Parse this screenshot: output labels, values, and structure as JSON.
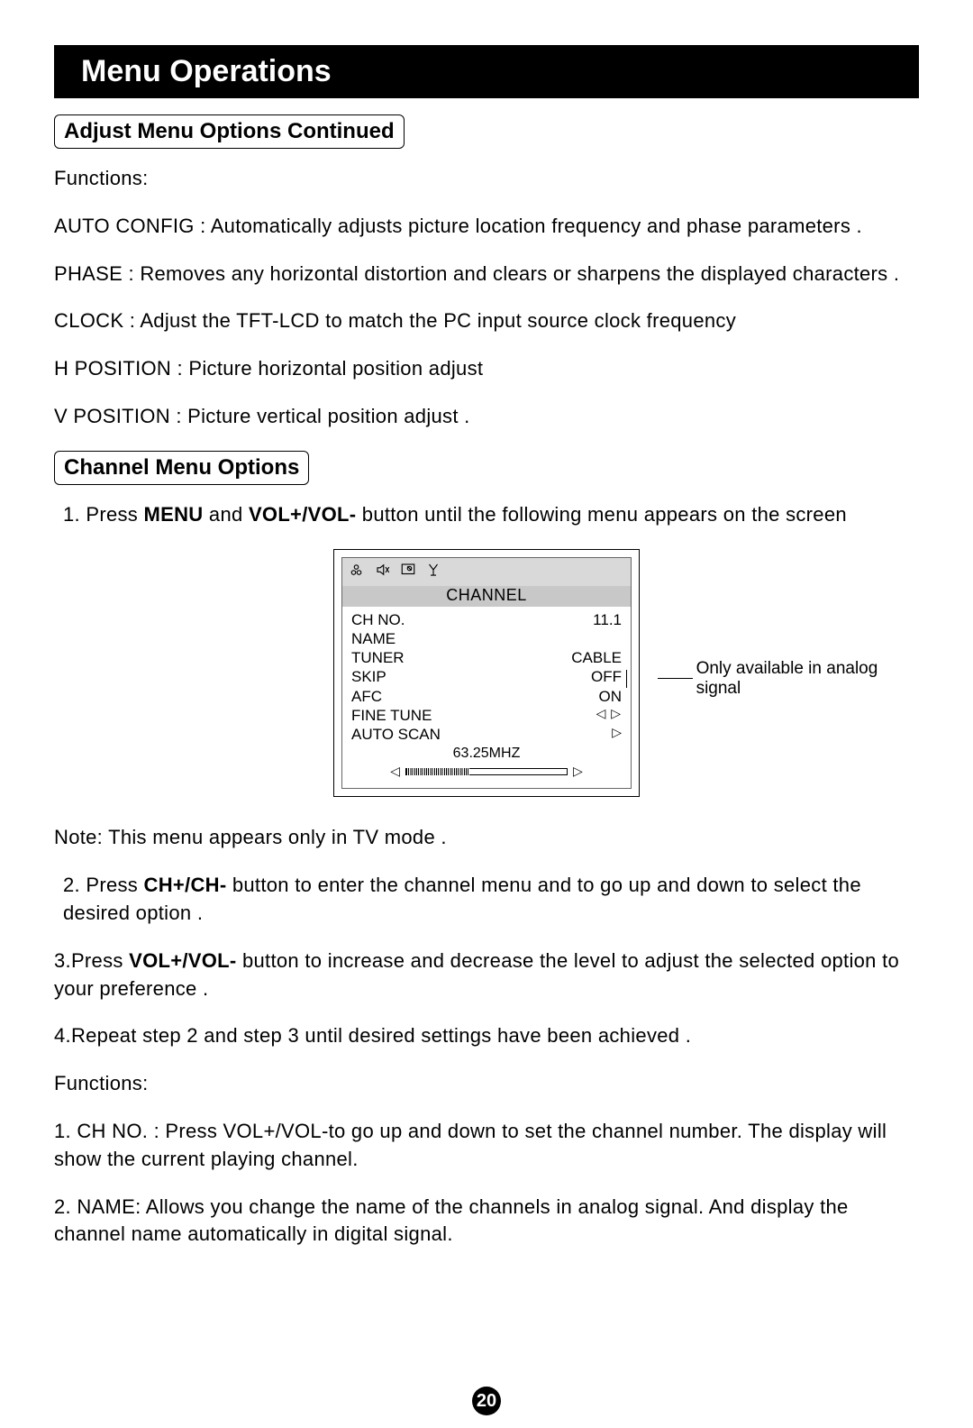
{
  "header": "Menu Operations",
  "section1": {
    "title": "Adjust  Menu Options Continued",
    "functions_label": "Functions:",
    "items": [
      "AUTO CONFIG : Automatically adjusts picture location frequency and phase parameters .",
      "PHASE : Removes any horizontal distortion and clears or sharpens the displayed characters .",
      "CLOCK : Adjust the TFT-LCD to match the PC input source clock frequency",
      "H POSITION : Picture horizontal position adjust",
      "V POSITION : Picture vertical position adjust ."
    ]
  },
  "section2": {
    "title": "Channel Menu  Options",
    "step1_prefix": " 1. Press ",
    "step1_bold1": "MENU",
    "step1_mid": " and ",
    "step1_bold2": "VOL+/VOL-",
    "step1_suffix": " button until the following menu appears on the screen",
    "note": " Note: This menu   appears only in   TV mode .",
    "step2_prefix": " 2. Press ",
    "step2_bold": "CH+/CH-",
    "step2_suffix": " button to enter the channel menu and to go up and down to select the desired option .",
    "step3_prefix": "3.Press ",
    "step3_bold": "VOL+/VOL-",
    "step3_suffix": " button to increase and decrease the level to adjust the selected option to your preference .",
    "step4": "4.Repeat step 2 and step 3 until desired settings have been achieved .",
    "functions_label": "Functions:",
    "func1": "1. CH NO. : Press VOL+/VOL-to go up and down to set the   channel number. The display will show the current playing channel.",
    "func2": "2. NAME: Allows you change the name of the channels in analog signal. And display the channel name automatically in digital signal."
  },
  "osd": {
    "title": "CHANNEL",
    "rows": [
      {
        "label": "CH NO.",
        "value": "11.1"
      },
      {
        "label": "NAME",
        "value": ""
      },
      {
        "label": "TUNER",
        "value": "CABLE"
      },
      {
        "label": "SKIP",
        "value": "OFF"
      },
      {
        "label": "AFC",
        "value": "ON"
      },
      {
        "label": "FINE TUNE",
        "value": "◁ ▷",
        "arrows": true
      },
      {
        "label": "AUTO SCAN",
        "value": "▷",
        "rarrow": true
      }
    ],
    "freq": "63.25MHZ",
    "callout": "Only available in analog signal"
  },
  "page_number": "20"
}
